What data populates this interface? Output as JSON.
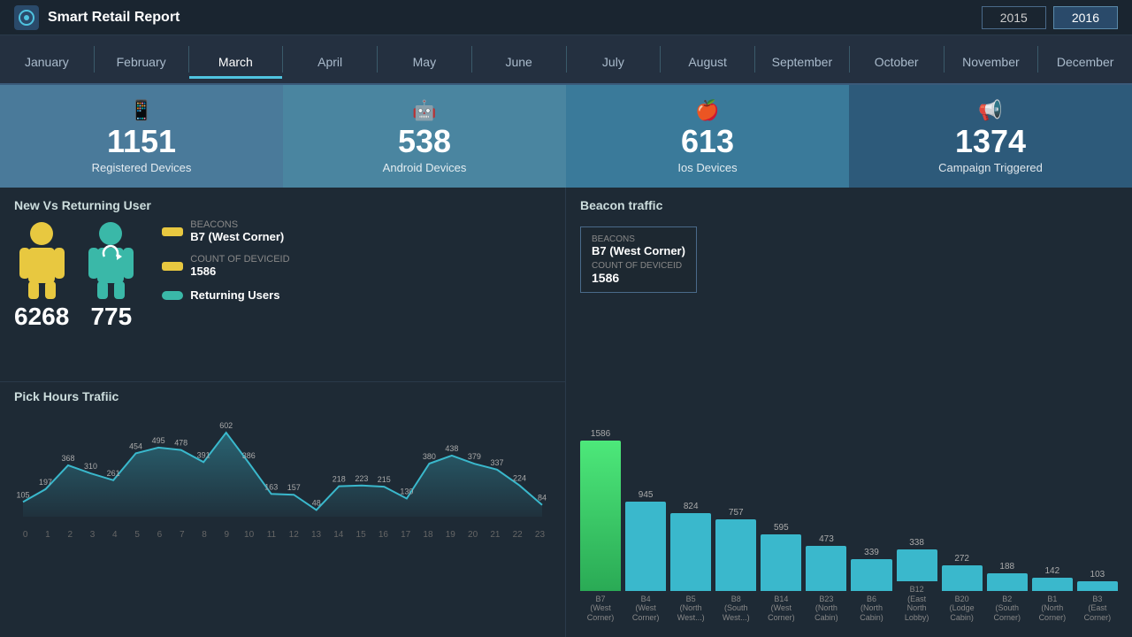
{
  "header": {
    "title": "Smart Retail Report",
    "years": [
      "2015",
      "2016"
    ],
    "active_year": "2016"
  },
  "months": [
    {
      "label": "January",
      "active": false
    },
    {
      "label": "February",
      "active": false
    },
    {
      "label": "March",
      "active": true
    },
    {
      "label": "April",
      "active": false
    },
    {
      "label": "May",
      "active": false
    },
    {
      "label": "June",
      "active": false
    },
    {
      "label": "July",
      "active": false
    },
    {
      "label": "August",
      "active": false
    },
    {
      "label": "September",
      "active": false
    },
    {
      "label": "October",
      "active": false
    },
    {
      "label": "November",
      "active": false
    },
    {
      "label": "December",
      "active": false
    }
  ],
  "stats": [
    {
      "icon": "📱",
      "value": "1151",
      "label": "Registered Devices"
    },
    {
      "icon": "🤖",
      "value": "538",
      "label": "Android Devices"
    },
    {
      "icon": "🍎",
      "value": "613",
      "label": "Ios Devices"
    },
    {
      "icon": "📢",
      "value": "1374",
      "label": "Campaign Triggered"
    }
  ],
  "new_vs_returning": {
    "title": "New Vs Returning User",
    "new_count": "6268",
    "returning_count": "775",
    "legend": {
      "beacons_label": "BEACONS",
      "beacons_name": "B7 (West Corner)",
      "count_label": "COUNT OF DEVICEID",
      "count_value": "1586",
      "returning_label": "Returning Users"
    }
  },
  "beacon_traffic": {
    "title": "Beacon traffic",
    "bars": [
      {
        "id": "B7",
        "label": "B7\n(West\nCorner)",
        "value": 1586,
        "active": true
      },
      {
        "id": "B4",
        "label": "B4\n(West\nCorner)",
        "value": 945
      },
      {
        "id": "B5",
        "label": "B5\n(North\nWest...)",
        "value": 824
      },
      {
        "id": "B8",
        "label": "B8\n(South\nWest...)",
        "value": 757
      },
      {
        "id": "B14",
        "label": "B14\n(West\nCorner)",
        "value": 595
      },
      {
        "id": "B23",
        "label": "B23\n(North\nCabin)",
        "value": 473
      },
      {
        "id": "B6",
        "label": "B6\n(North\nCabin)",
        "value": 339
      },
      {
        "id": "B12",
        "label": "B12\n(East\nNorth Lobby)",
        "value": 338
      },
      {
        "id": "B20",
        "label": "B20\n(Lodge\nCabin)",
        "value": 272
      },
      {
        "id": "B2",
        "label": "B2\n(South\nCorner)",
        "value": 188
      },
      {
        "id": "B1",
        "label": "B1\n(North\nCorner)",
        "value": 142
      },
      {
        "id": "B3",
        "label": "B3\n(East\nCorner)",
        "value": 103
      }
    ]
  },
  "peak_hours": {
    "title": "Pick Hours Trafiic",
    "data": [
      105,
      197,
      368,
      310,
      261,
      454,
      495,
      478,
      391,
      602,
      386,
      163,
      157,
      48,
      218,
      223,
      215,
      130,
      380,
      438,
      379,
      337,
      224,
      84
    ],
    "x_labels": [
      "0",
      "1",
      "2",
      "3",
      "4",
      "5",
      "6",
      "7",
      "8",
      "9",
      "10",
      "11",
      "12",
      "13",
      "14",
      "15",
      "16",
      "17",
      "18",
      "19",
      "20",
      "21",
      "22",
      "23"
    ]
  }
}
